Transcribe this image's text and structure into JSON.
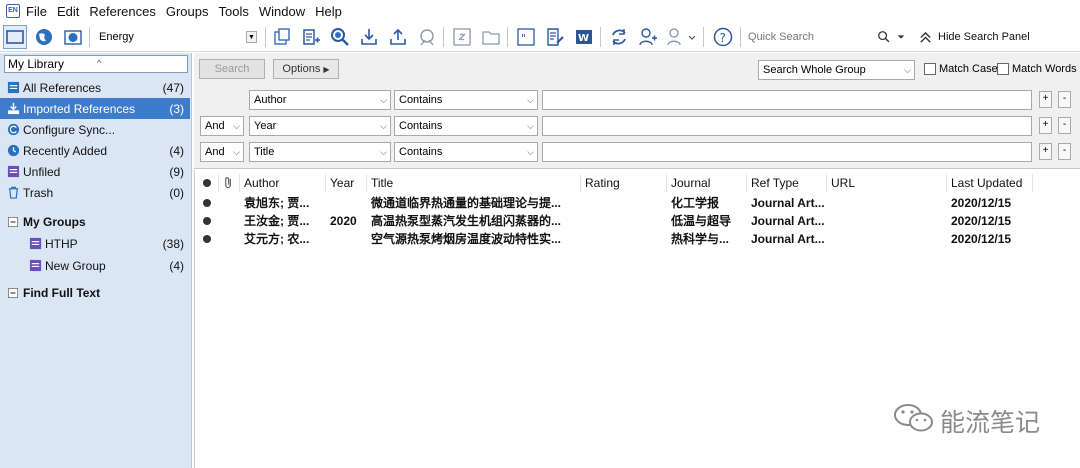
{
  "app": {
    "logo_text": "EN"
  },
  "menu": [
    "File",
    "Edit",
    "References",
    "Groups",
    "Tools",
    "Window",
    "Help"
  ],
  "toolbar": {
    "group_name": "Energy",
    "quick_search_placeholder": "Quick Search",
    "hide_panel_label": "Hide Search Panel"
  },
  "sidebar": {
    "library_select": "My Library",
    "items": [
      {
        "label": "All References",
        "count": "(47)"
      },
      {
        "label": "Imported References",
        "count": "(3)"
      },
      {
        "label": "Configure Sync...",
        "count": ""
      },
      {
        "label": "Recently Added",
        "count": "(4)"
      },
      {
        "label": "Unfiled",
        "count": "(9)"
      },
      {
        "label": "Trash",
        "count": "(0)"
      }
    ],
    "my_groups_label": "My Groups",
    "groups": [
      {
        "label": "HTHP",
        "count": "(38)"
      },
      {
        "label": "New Group",
        "count": "(4)"
      }
    ],
    "find_full_text_label": "Find Full Text"
  },
  "search": {
    "search_button": "Search",
    "options_button": "Options",
    "scope": "Search Whole Group",
    "match_case": "Match Case",
    "match_words": "Match Words",
    "rows": [
      {
        "bool": "",
        "field": "Author",
        "op": "Contains"
      },
      {
        "bool": "And",
        "field": "Year",
        "op": "Contains"
      },
      {
        "bool": "And",
        "field": "Title",
        "op": "Contains"
      }
    ],
    "plus": "+",
    "minus": "-"
  },
  "table": {
    "columns": [
      "Author",
      "Year",
      "Title",
      "Rating",
      "Journal",
      "Ref Type",
      "URL",
      "Last Updated"
    ],
    "rows": [
      {
        "author": "袁旭东; 贾...",
        "year": "",
        "title": "微通道临界热通量的基础理论与提...",
        "rating": "",
        "journal": "化工学报",
        "reftype": "Journal Art...",
        "url": "",
        "updated": "2020/12/15"
      },
      {
        "author": "王汝金; 贾...",
        "year": "2020",
        "title": "高温热泵型蒸汽发生机组闪蒸器的...",
        "rating": "",
        "journal": "低温与超导",
        "reftype": "Journal Art...",
        "url": "",
        "updated": "2020/12/15"
      },
      {
        "author": "艾元方; 农...",
        "year": "",
        "title": "空气源热泵烤烟房温度波动特性实...",
        "rating": "",
        "journal": "热科学与...",
        "reftype": "Journal Art...",
        "url": "",
        "updated": "2020/12/15"
      }
    ]
  },
  "watermark": "能流笔记"
}
